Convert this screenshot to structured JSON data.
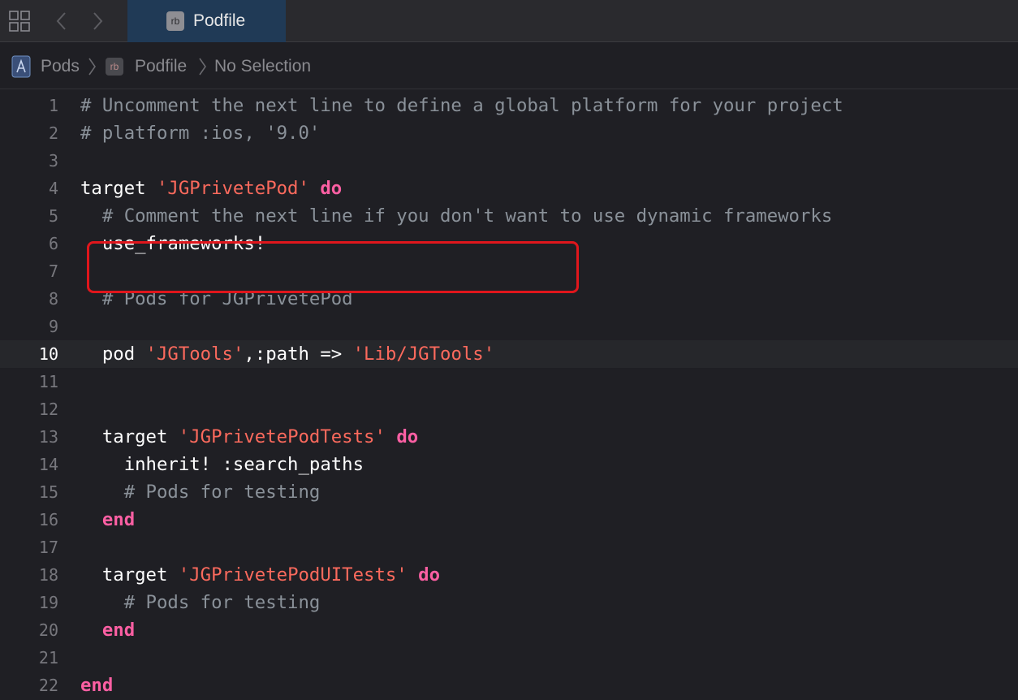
{
  "tabbar": {
    "grid_icon": "grid-icon",
    "back_icon": "chevron-left-icon",
    "forward_icon": "chevron-right-icon",
    "active_tab": {
      "badge": "rb",
      "label": "Podfile"
    }
  },
  "jumpbar": {
    "items": [
      {
        "icon": "xcodeproj-icon",
        "label": "Pods"
      },
      {
        "icon": "ruby-file-icon",
        "badge": "rb",
        "label": "Podfile"
      },
      {
        "label": "No Selection"
      }
    ]
  },
  "editor": {
    "current_line": 10,
    "lines": [
      {
        "n": "1",
        "tokens": [
          {
            "t": "comment",
            "s": "# Uncomment the next line to define a global platform for your project"
          }
        ]
      },
      {
        "n": "2",
        "tokens": [
          {
            "t": "comment",
            "s": "# platform :ios, '9.0'"
          }
        ]
      },
      {
        "n": "3",
        "tokens": []
      },
      {
        "n": "4",
        "tokens": [
          {
            "t": "plain",
            "s": "target "
          },
          {
            "t": "string",
            "s": "'JGPrivetePod'"
          },
          {
            "t": "plain",
            "s": " "
          },
          {
            "t": "keyword",
            "s": "do"
          }
        ]
      },
      {
        "n": "5",
        "tokens": [
          {
            "t": "comment",
            "s": "  # Comment the next line if you don't want to use dynamic frameworks"
          }
        ]
      },
      {
        "n": "6",
        "tokens": [
          {
            "t": "plain",
            "s": "  use_frameworks!"
          }
        ]
      },
      {
        "n": "7",
        "tokens": []
      },
      {
        "n": "8",
        "tokens": [
          {
            "t": "comment",
            "s": "  # Pods for JGPrivetePod"
          }
        ]
      },
      {
        "n": "9",
        "tokens": []
      },
      {
        "n": "10",
        "tokens": [
          {
            "t": "plain",
            "s": "  pod "
          },
          {
            "t": "string",
            "s": "'JGTools'"
          },
          {
            "t": "plain",
            "s": ",:path => "
          },
          {
            "t": "string",
            "s": "'Lib/JGTools'"
          }
        ]
      },
      {
        "n": "11",
        "tokens": []
      },
      {
        "n": "12",
        "tokens": []
      },
      {
        "n": "13",
        "tokens": [
          {
            "t": "plain",
            "s": "  target "
          },
          {
            "t": "string",
            "s": "'JGPrivetePodTests'"
          },
          {
            "t": "plain",
            "s": " "
          },
          {
            "t": "keyword",
            "s": "do"
          }
        ]
      },
      {
        "n": "14",
        "tokens": [
          {
            "t": "plain",
            "s": "    inherit! :search_paths"
          }
        ]
      },
      {
        "n": "15",
        "tokens": [
          {
            "t": "comment",
            "s": "    # Pods for testing"
          }
        ]
      },
      {
        "n": "16",
        "tokens": [
          {
            "t": "plain",
            "s": "  "
          },
          {
            "t": "keyword",
            "s": "end"
          }
        ]
      },
      {
        "n": "17",
        "tokens": []
      },
      {
        "n": "18",
        "tokens": [
          {
            "t": "plain",
            "s": "  target "
          },
          {
            "t": "string",
            "s": "'JGPrivetePodUITests'"
          },
          {
            "t": "plain",
            "s": " "
          },
          {
            "t": "keyword",
            "s": "do"
          }
        ]
      },
      {
        "n": "19",
        "tokens": [
          {
            "t": "comment",
            "s": "    # Pods for testing"
          }
        ]
      },
      {
        "n": "20",
        "tokens": [
          {
            "t": "plain",
            "s": "  "
          },
          {
            "t": "keyword",
            "s": "end"
          }
        ]
      },
      {
        "n": "21",
        "tokens": []
      },
      {
        "n": "22",
        "tokens": [
          {
            "t": "keyword",
            "s": "end"
          }
        ]
      }
    ]
  },
  "annotation": {
    "box_color": "#e0161c"
  },
  "colors": {
    "background": "#1f1f24",
    "tabbar": "#2a2a2e",
    "active_tab": "#203a56",
    "comment": "#8a9199",
    "string": "#fc6a5d",
    "keyword": "#fc5fa3",
    "plain": "#ffffff"
  }
}
